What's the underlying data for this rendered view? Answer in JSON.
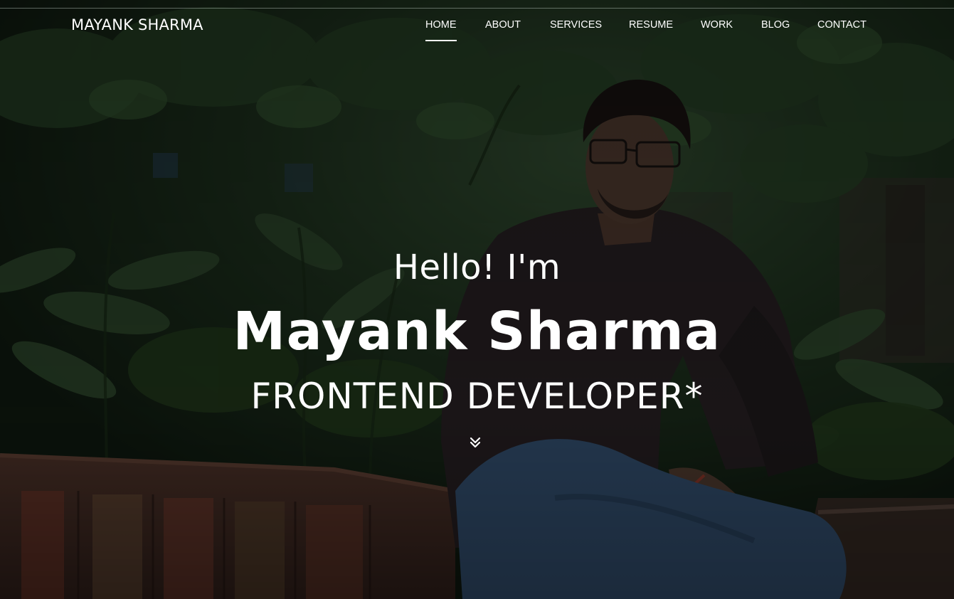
{
  "nav": {
    "brand": "MAYANK SHARMA",
    "items": [
      {
        "label": "HOME",
        "active": true
      },
      {
        "label": "ABOUT",
        "active": false
      },
      {
        "label": "SERVICES",
        "active": false
      },
      {
        "label": "RESUME",
        "active": false
      },
      {
        "label": "WORK",
        "active": false
      },
      {
        "label": "BLOG",
        "active": false
      },
      {
        "label": "CONTACT",
        "active": false
      }
    ]
  },
  "hero": {
    "greeting": "Hello! I'm",
    "name": "Mayank Sharma",
    "role": "FRONTEND DEVELOPER*",
    "scroll_icon": "double-chevron-down-icon"
  },
  "colors": {
    "text": "#ffffff",
    "overlay": "#0d1a0e",
    "foliage": "#2f4a2c",
    "shirt": "#2a2225",
    "jeans": "#3a5f88",
    "ledge": "#8a5040"
  }
}
